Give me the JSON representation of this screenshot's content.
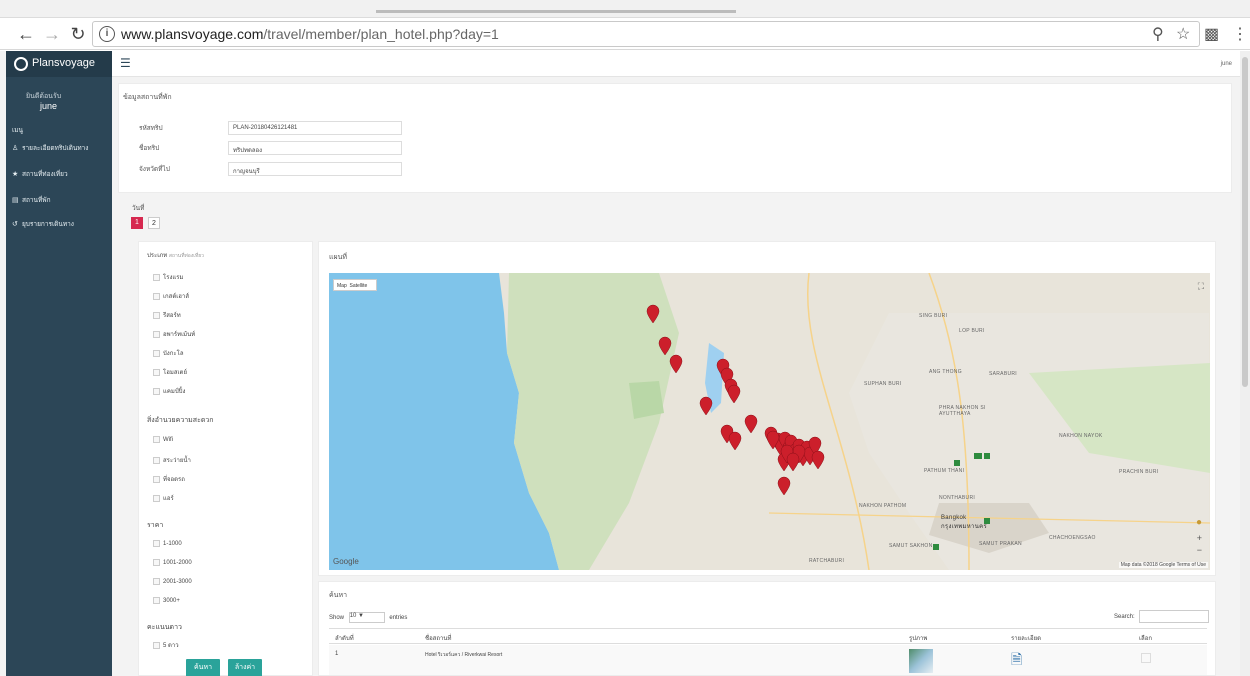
{
  "browser": {
    "url_domain": "www.plansvoyage.com",
    "url_path": "/travel/member/plan_hotel.php?day=1"
  },
  "sidebar": {
    "brand": "Plansvoyage",
    "welcome": "ยินดีต้อนรับ",
    "username": "june",
    "menu_header": "เมนู",
    "items": [
      {
        "label": "รายละเอียดทริปเดินทาง",
        "icon": "person-icon"
      },
      {
        "label": "สถานที่ท่องเที่ยว",
        "icon": "star-icon"
      },
      {
        "label": "สถานที่พัก",
        "icon": "bed-icon"
      },
      {
        "label": "ยุบรายการเดินทาง",
        "icon": "history-icon"
      }
    ]
  },
  "topbar": {
    "user": "june"
  },
  "plan_info": {
    "section_title": "ข้อมูลสถานที่พัก",
    "fields": [
      {
        "label": "รหัสทริป",
        "value": "PLAN-20180426121481"
      },
      {
        "label": "ชื่อทริป",
        "value": "ทริปทดลอง"
      },
      {
        "label": "จังหวัดที่ไป",
        "value": "กาญจนบุรี"
      }
    ]
  },
  "days": {
    "label": "วันที่",
    "buttons": [
      "1",
      "2"
    ],
    "active": "1"
  },
  "filters": {
    "type_title": "ประเภท",
    "type_subtitle": "สถานที่ท่องเที่ยว",
    "types": [
      "โรงแรม",
      "เกสต์เฮาส์",
      "รีสอร์ท",
      "อพาร์ทเม้นท์",
      "บังกะโล",
      "โฮมสเตย์",
      "แคมป์ปิ้ง"
    ],
    "facility_title": "สิ่งอำนวยความสะดวก",
    "facilities": [
      "Wifi",
      "สระว่ายน้ำ",
      "ที่จอดรถ",
      "แอร์"
    ],
    "price_title": "ราคา",
    "prices": [
      "1-1000",
      "1001-2000",
      "2001-3000",
      "3000+"
    ],
    "rating_title": "คะแนนดาว",
    "ratings": [
      "5 ดาว"
    ],
    "search_button": "ค้นหา",
    "reset_button": "ล้างค่า"
  },
  "map_panel": {
    "title": "แผนที่",
    "map_type": "Map",
    "satellite": "Satellite",
    "google": "Google",
    "attribution": "Map data ©2018 Google  Terms of Use",
    "places": [
      "SING BURI",
      "LOP BURI",
      "SUPHAN BURI",
      "ANG THONG",
      "SARABURI",
      "PHRA NAKHON SI AYUTTHAYA",
      "NAKHON NAYOK",
      "PATHUM THANI",
      "NONTHABURI",
      "Bangkok กรุงเทพมหานคร",
      "NAKHON PATHOM",
      "SAMUT SAKHON",
      "SAMUT PRAKAN",
      "RATCHABURI",
      "CHACHOENGSAO",
      "PRACHIN BURI"
    ]
  },
  "results": {
    "title": "ค้นหา",
    "show_label": "Show",
    "page_size": "10",
    "entries_label": "entries",
    "search_label": "Search:",
    "columns": [
      "ลำดับที่",
      "ชื่อสถานที่",
      "รูปภาพ",
      "รายละเอียด",
      "เลือก"
    ],
    "rows": [
      {
        "no": "1",
        "name": "Hotel ริเวอร์แคว / Riverkwai Resort"
      }
    ]
  },
  "colors": {
    "sidebar": "#2c4657",
    "accent_red": "#d6284f",
    "button_green": "#2aa39a",
    "marker_red": "#cc1f2b",
    "marker_green": "#2e8b3e",
    "water": "#7fc4ea"
  },
  "map_markers_count": 30
}
